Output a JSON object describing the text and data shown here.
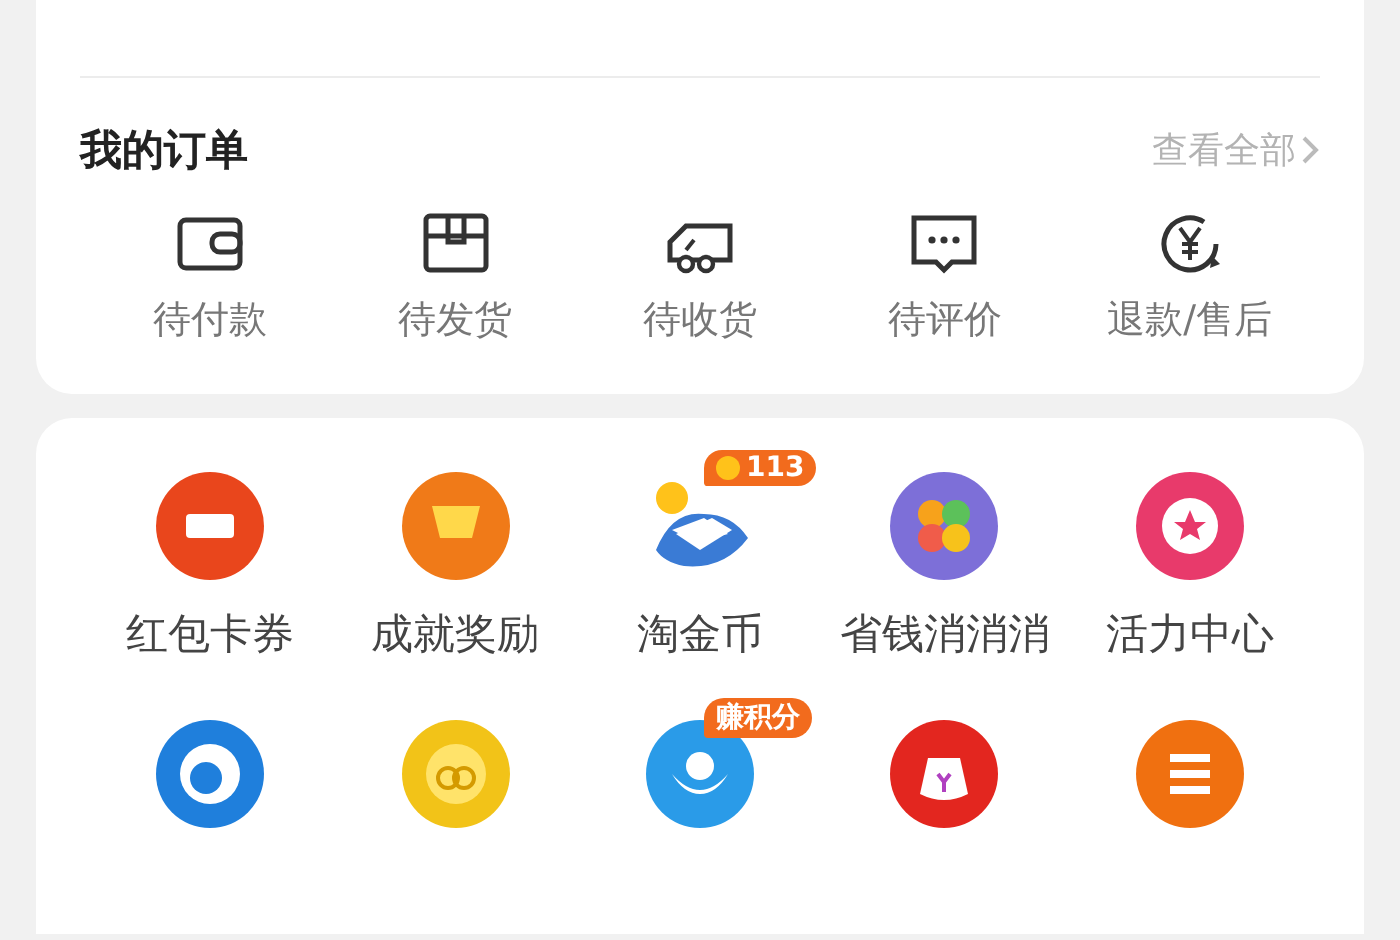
{
  "orders": {
    "title": "我的订单",
    "view_all": "查看全部",
    "items": [
      {
        "label": "待付款",
        "kind": "wallet"
      },
      {
        "label": "待发货",
        "kind": "box"
      },
      {
        "label": "待收货",
        "kind": "truck"
      },
      {
        "label": "待评价",
        "kind": "comment"
      },
      {
        "label": "退款/售后",
        "kind": "refund"
      }
    ]
  },
  "services": {
    "items": [
      {
        "label": "红包卡券",
        "kind": "ticket",
        "color": "#e9461c"
      },
      {
        "label": "成就奖励",
        "kind": "trophy",
        "color": "#f07a18"
      },
      {
        "label": "淘金币",
        "kind": "coin-bird",
        "color": "#3a7bd5",
        "badge": "113",
        "badge_coin": true
      },
      {
        "label": "省钱消消消",
        "kind": "candy",
        "color": "#7d6fd8"
      },
      {
        "label": "活力中心",
        "kind": "star",
        "color": "#e83a6b"
      },
      {
        "kind": "bird",
        "color": "#1f7fdc"
      },
      {
        "kind": "coin",
        "color": "#f2c318"
      },
      {
        "kind": "wings",
        "color": "#2a9be8",
        "badge": "赚积分",
        "badge_coin": false
      },
      {
        "kind": "moneybag",
        "color": "#e3261f"
      },
      {
        "kind": "list",
        "color": "#f07010"
      }
    ]
  }
}
